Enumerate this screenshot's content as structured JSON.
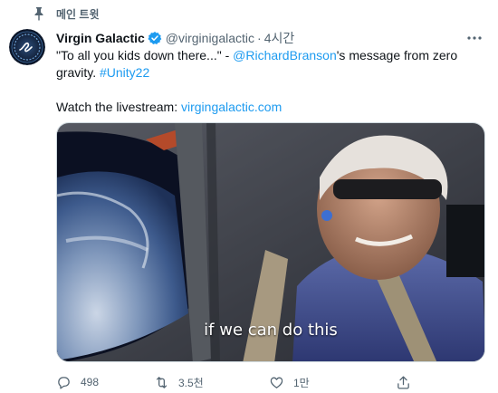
{
  "pinned": {
    "label": "메인 트윗"
  },
  "tweet": {
    "display_name": "Virgin Galactic",
    "handle": "@virginigalactic",
    "separator": "·",
    "time": "4시간",
    "text_part1": "\"To all you kids down there...\" - ",
    "mention": "@RichardBranson",
    "text_part2": "'s message from zero gravity. ",
    "hashtag": "#Unity22",
    "watch_text": "Watch the livestream: ",
    "watch_link": "virgingalactic.com",
    "video_caption": "if we can do this"
  },
  "actions": {
    "reply_count": "498",
    "retweet_count": "3.5천",
    "like_count": "1만"
  },
  "colors": {
    "accent": "#1d9bf0",
    "muted": "#536471",
    "text": "#0f1419"
  }
}
